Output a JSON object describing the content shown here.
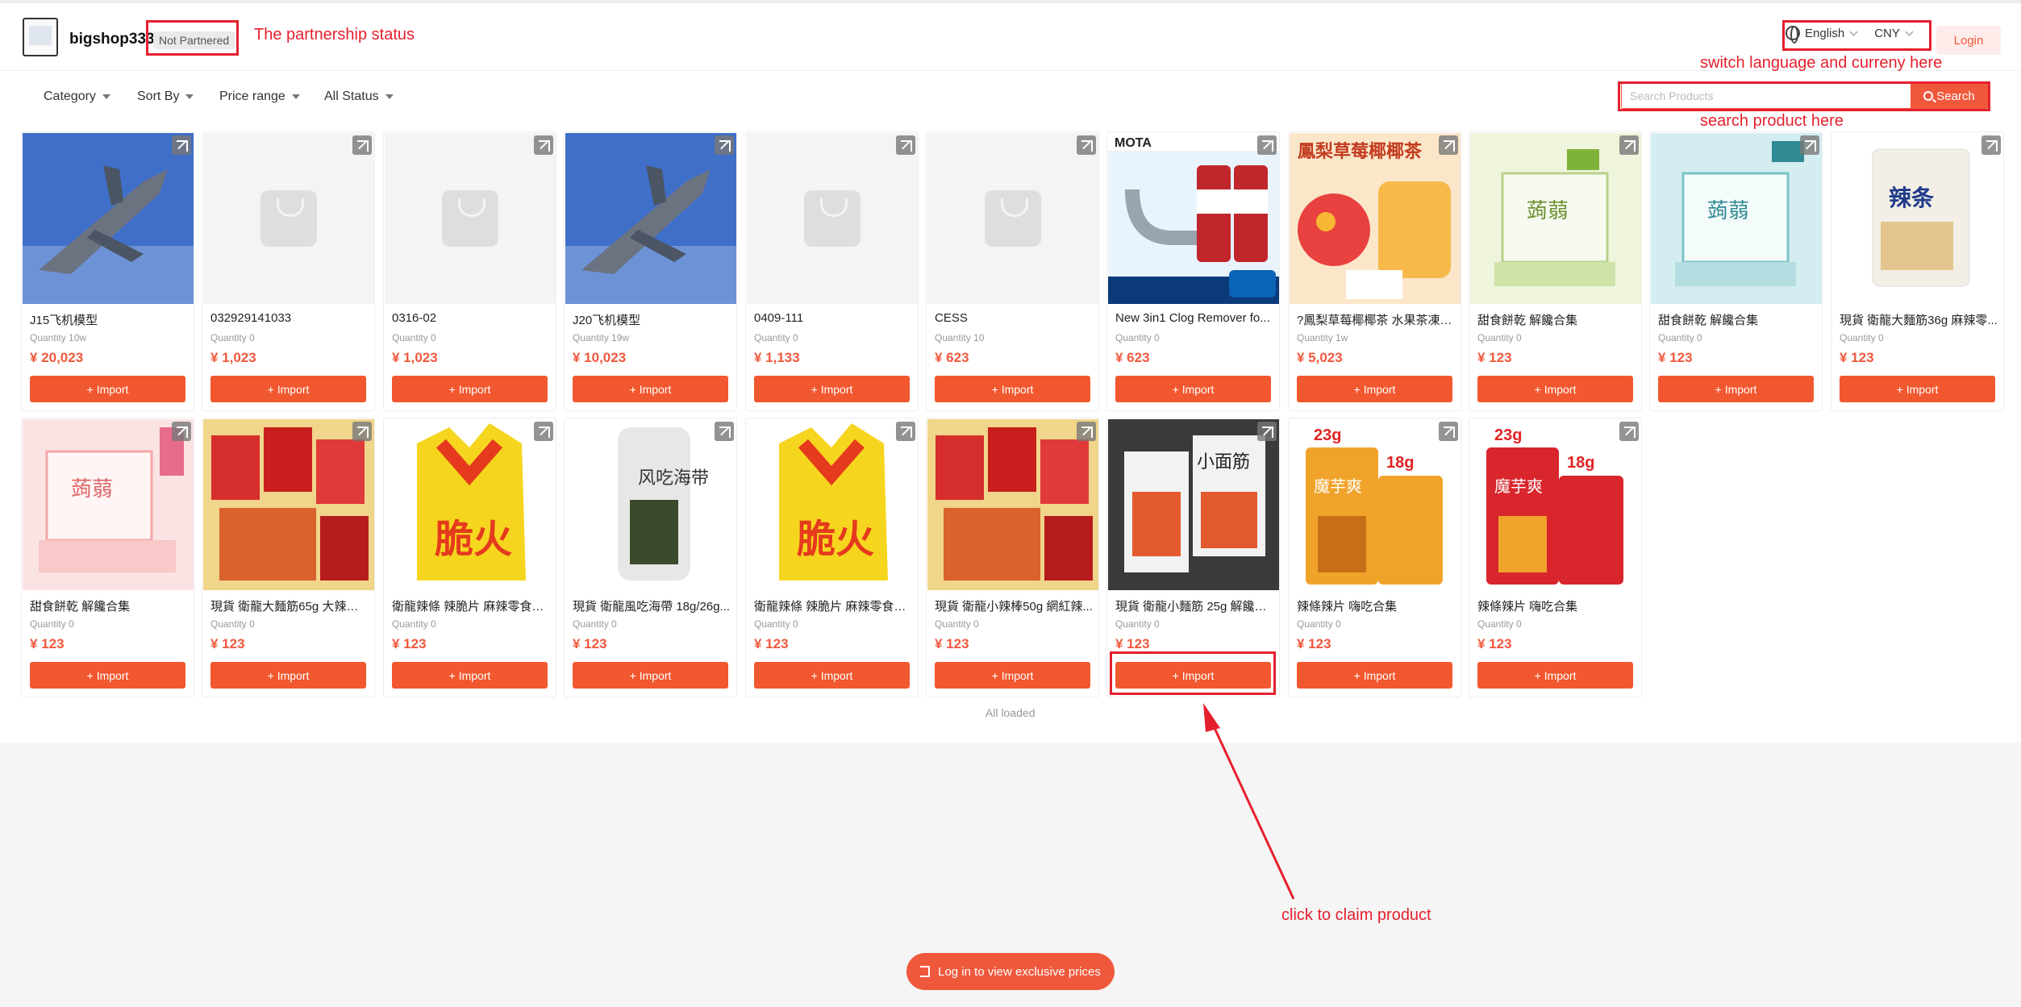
{
  "shop": {
    "name": "bigshop333",
    "status": "Not Partnered"
  },
  "header": {
    "language": "English",
    "currency": "CNY",
    "login": "Login"
  },
  "filters": {
    "category": "Category",
    "sort": "Sort By",
    "price": "Price range",
    "status": "All Status"
  },
  "search": {
    "placeholder": "Search Products",
    "button": "Search"
  },
  "annotations": {
    "status": "The partnership status",
    "lang": "switch language and curreny here",
    "search": "search product here",
    "claim": "click to claim product"
  },
  "import_label": "+ Import",
  "products": [
    {
      "title": "J15飞机模型",
      "qty": "Quantity 10w",
      "price": "¥ 20,023",
      "image": "jet-photo"
    },
    {
      "title": "032929141033",
      "qty": "Quantity 0",
      "price": "¥ 1,023",
      "image": "placeholder"
    },
    {
      "title": "0316-02",
      "qty": "Quantity 0",
      "price": "¥ 1,023",
      "image": "placeholder"
    },
    {
      "title": "J20飞机模型",
      "qty": "Quantity 19w",
      "price": "¥ 10,023",
      "image": "jet-photo"
    },
    {
      "title": "0409-111",
      "qty": "Quantity 0",
      "price": "¥ 1,133",
      "image": "placeholder"
    },
    {
      "title": "CESS",
      "qty": "Quantity 10",
      "price": "¥ 623",
      "image": "placeholder"
    },
    {
      "title": "New 3in1 Clog Remover fo...",
      "qty": "Quantity 0",
      "price": "¥ 623",
      "image": "clog-remover"
    },
    {
      "title": "?鳳梨草莓椰椰茶 水果茶凍幹...",
      "qty": "Quantity 1w",
      "price": "¥ 5,023",
      "image": "fruit-tea"
    },
    {
      "title": "甜食餅乾 解饞合集",
      "qty": "Quantity 0",
      "price": "¥ 123",
      "image": "green-box"
    },
    {
      "title": "甜食餅乾 解饞合集",
      "qty": "Quantity 0",
      "price": "¥ 123",
      "image": "teal-box"
    },
    {
      "title": "現貨 衛龍大麵筋36g 麻辣零...",
      "qty": "Quantity 0",
      "price": "¥ 123",
      "image": "white-snack"
    },
    {
      "title": "甜食餅乾 解饞合集",
      "qty": "Quantity 0",
      "price": "¥ 123",
      "image": "pink-box"
    },
    {
      "title": "現貨 衛龍大麵筋65g 大辣條 ...",
      "qty": "Quantity 0",
      "price": "¥ 123",
      "image": "snack-assortment"
    },
    {
      "title": "衛龍辣條 辣脆片 麻辣零食辣...",
      "qty": "Quantity 0",
      "price": "¥ 123",
      "image": "yellow-bag"
    },
    {
      "title": "現貨 衛龍風吃海帶 18g/26g...",
      "qty": "Quantity 0",
      "price": "¥ 123",
      "image": "seaweed-pack"
    },
    {
      "title": "衛龍辣條 辣脆片 麻辣零食辣...",
      "qty": "Quantity 0",
      "price": "¥ 123",
      "image": "yellow-bag"
    },
    {
      "title": "現貨 衛龍小辣棒50g 網紅辣...",
      "qty": "Quantity 0",
      "price": "¥ 123",
      "image": "snack-assortment"
    },
    {
      "title": "現貨 衛龍小麵筋 25g 解饞小...",
      "qty": "Quantity 0",
      "price": "¥ 123",
      "image": "dark-snack"
    },
    {
      "title": "辣條辣片 嗨吃合集",
      "qty": "Quantity 0",
      "price": "¥ 123",
      "image": "orange-pack"
    },
    {
      "title": "辣條辣片 嗨吃合集",
      "qty": "Quantity 0",
      "price": "¥ 123",
      "image": "red-pack"
    }
  ],
  "product_image_text": {
    "clog": "MOTA",
    "tea": "鳳梨草莓椰椰茶",
    "latiao": "辣条",
    "green": "蒟蒻",
    "hot": "脆火",
    "wind": "风吃海带",
    "small": "小面筋",
    "g23": "23g",
    "g18": "18g",
    "moyu": "魔芋爽"
  },
  "footer": {
    "loaded": "All loaded",
    "login_prompt": "Log in to view exclusive prices"
  },
  "colors": {
    "accent": "#f0583c",
    "annotation": "#e5202e"
  }
}
